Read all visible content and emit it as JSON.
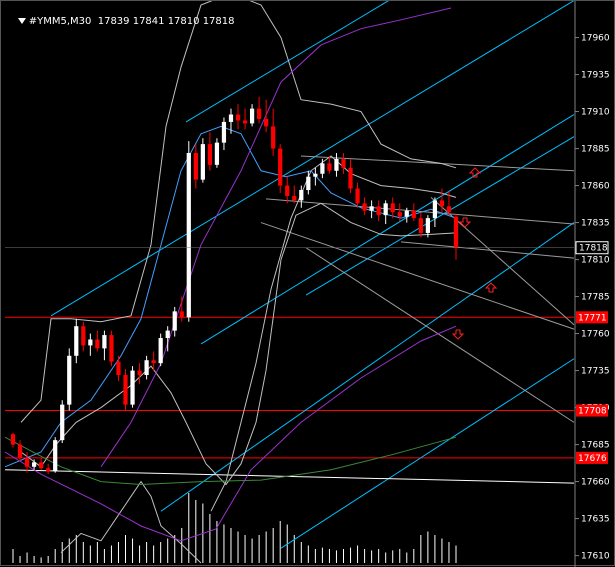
{
  "header": {
    "symbol_timeframe": "#YMM5,M30",
    "ohlc": "17839 17841 17810 17818"
  },
  "colors": {
    "background": "#000000",
    "bull_candle": "#ffffff",
    "bear_candle": "#ff0000",
    "level_line": "#ff0000",
    "channel": "#00bfff",
    "bands": "#c0c0c0",
    "ma_purple": "#9933cc",
    "ma_green": "#3a8a3a",
    "arrow": "#ff2020"
  },
  "chart_data": {
    "type": "candlestick",
    "y_axis_ticks": [
      17960,
      17935,
      17910,
      17885,
      17860,
      17835,
      17810,
      17785,
      17760,
      17735,
      17710,
      17685,
      17660,
      17635,
      17610
    ],
    "ylim": [
      17605,
      17982
    ],
    "current_price": "17818",
    "levels": [
      {
        "value": 17771,
        "label": "17771"
      },
      {
        "value": 17708,
        "label": "17708"
      },
      {
        "value": 17676,
        "label": "17676"
      }
    ],
    "candles": [
      [
        17692,
        17693,
        17683,
        17685
      ],
      [
        17685,
        17688,
        17674,
        17676
      ],
      [
        17676,
        17680,
        17666,
        17670
      ],
      [
        17670,
        17675,
        17668,
        17673
      ],
      [
        17673,
        17676,
        17668,
        17669
      ],
      [
        17669,
        17672,
        17665,
        17667
      ],
      [
        17667,
        17690,
        17666,
        17688
      ],
      [
        17688,
        17715,
        17686,
        17712
      ],
      [
        17712,
        17750,
        17708,
        17745
      ],
      [
        17745,
        17770,
        17740,
        17765
      ],
      [
        17765,
        17768,
        17748,
        17752
      ],
      [
        17752,
        17760,
        17745,
        17756
      ],
      [
        17756,
        17762,
        17748,
        17750
      ],
      [
        17750,
        17762,
        17742,
        17759
      ],
      [
        17759,
        17762,
        17738,
        17741
      ],
      [
        17741,
        17745,
        17728,
        17732
      ],
      [
        17732,
        17736,
        17708,
        17712
      ],
      [
        17712,
        17738,
        17710,
        17735
      ],
      [
        17735,
        17740,
        17726,
        17732
      ],
      [
        17732,
        17745,
        17729,
        17742
      ],
      [
        17742,
        17748,
        17735,
        17740
      ],
      [
        17740,
        17760,
        17738,
        17757
      ],
      [
        17757,
        17765,
        17748,
        17762
      ],
      [
        17762,
        17778,
        17758,
        17775
      ],
      [
        17775,
        17785,
        17768,
        17771
      ],
      [
        17771,
        17890,
        17768,
        17882
      ],
      [
        17882,
        17888,
        17858,
        17864
      ],
      [
        17864,
        17892,
        17862,
        17888
      ],
      [
        17888,
        17896,
        17870,
        17874
      ],
      [
        17874,
        17892,
        17872,
        17889
      ],
      [
        17889,
        17906,
        17884,
        17903
      ],
      [
        17903,
        17912,
        17895,
        17908
      ],
      [
        17908,
        17915,
        17898,
        17904
      ],
      [
        17904,
        17912,
        17898,
        17902
      ],
      [
        17902,
        17915,
        17900,
        17912
      ],
      [
        17912,
        17920,
        17902,
        17905
      ],
      [
        17905,
        17918,
        17896,
        17900
      ],
      [
        17900,
        17912,
        17880,
        17885
      ],
      [
        17885,
        17888,
        17855,
        17860
      ],
      [
        17860,
        17866,
        17848,
        17853
      ],
      [
        17853,
        17860,
        17848,
        17850
      ],
      [
        17850,
        17860,
        17845,
        17857
      ],
      [
        17857,
        17870,
        17854,
        17866
      ],
      [
        17866,
        17872,
        17860,
        17868
      ],
      [
        17868,
        17878,
        17865,
        17875
      ],
      [
        17875,
        17880,
        17868,
        17870
      ],
      [
        17870,
        17882,
        17866,
        17878
      ],
      [
        17878,
        17882,
        17868,
        17872
      ],
      [
        17872,
        17878,
        17855,
        17858
      ],
      [
        17858,
        17862,
        17845,
        17848
      ],
      [
        17848,
        17852,
        17840,
        17843
      ],
      [
        17843,
        17850,
        17838,
        17846
      ],
      [
        17846,
        17850,
        17836,
        17840
      ],
      [
        17840,
        17850,
        17834,
        17848
      ],
      [
        17848,
        17852,
        17838,
        17842
      ],
      [
        17842,
        17848,
        17836,
        17839
      ],
      [
        17839,
        17845,
        17835,
        17843
      ],
      [
        17843,
        17848,
        17836,
        17838
      ],
      [
        17838,
        17842,
        17825,
        17828
      ],
      [
        17828,
        17840,
        17825,
        17838
      ],
      [
        17838,
        17852,
        17832,
        17850
      ],
      [
        17850,
        17858,
        17842,
        17846
      ],
      [
        17846,
        17856,
        17840,
        17842
      ],
      [
        17839,
        17841,
        17810,
        17818
      ]
    ],
    "volume_heights": [
      0.2,
      0.1,
      0.15,
      0.1,
      0.08,
      0.1,
      0.2,
      0.3,
      0.35,
      0.4,
      0.3,
      0.25,
      0.3,
      0.2,
      0.25,
      0.3,
      0.4,
      0.35,
      0.25,
      0.3,
      0.25,
      0.3,
      0.35,
      0.4,
      0.5,
      1.0,
      0.9,
      0.85,
      0.7,
      0.6,
      0.55,
      0.5,
      0.45,
      0.4,
      0.35,
      0.4,
      0.45,
      0.5,
      0.6,
      0.55,
      0.4,
      0.3,
      0.25,
      0.2,
      0.22,
      0.2,
      0.18,
      0.2,
      0.22,
      0.25,
      0.2,
      0.18,
      0.2,
      0.15,
      0.18,
      0.2,
      0.15,
      0.2,
      0.4,
      0.45,
      0.4,
      0.35,
      0.3,
      0.25
    ]
  }
}
